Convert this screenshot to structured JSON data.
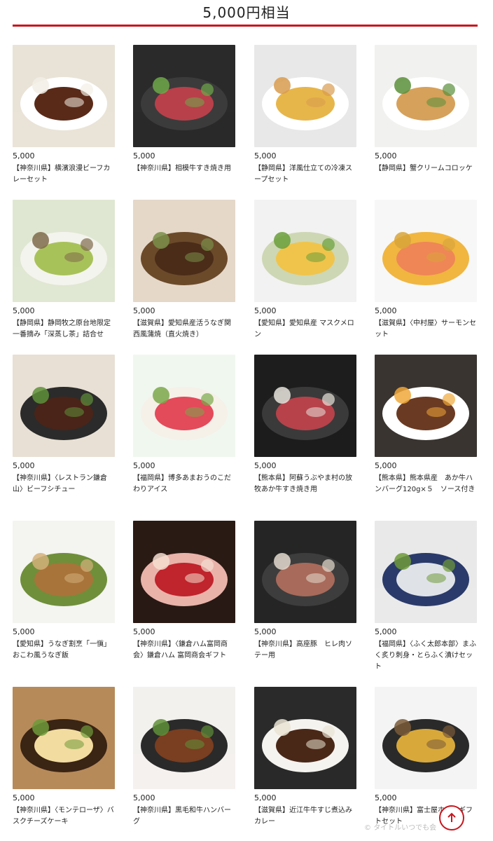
{
  "page_title": "5,000円相当",
  "accent_color": "#c8161d",
  "products": [
    {
      "price": "5,000",
      "name": "【神奈川県】横濱浪漫ビーフカレーセット",
      "thumb": "beef-curry-plate"
    },
    {
      "price": "5,000",
      "name": "【神奈川県】相模牛すき焼き用",
      "thumb": "sukiyaki-pan"
    },
    {
      "price": "5,000",
      "name": "【静岡県】洋風仕立ての冷凍スープセット",
      "thumb": "soup-bowls"
    },
    {
      "price": "5,000",
      "name": "【静岡県】蟹クリームコロッケ",
      "thumb": "croquettes"
    },
    {
      "price": "5,000",
      "name": "【静岡県】静岡牧之原台地限定一番摘み「深蒸し茶」詰合せ",
      "thumb": "green-tea"
    },
    {
      "price": "5,000",
      "name": "【滋賀県】愛知県産活うなぎ関西風蒲焼（直火焼き）",
      "thumb": "eel-kabayaki"
    },
    {
      "price": "5,000",
      "name": "【愛知県】愛知県産 マスクメロン",
      "thumb": "melon"
    },
    {
      "price": "5,000",
      "name": "【滋賀県】〈中村屋〉サーモンセット",
      "thumb": "salmon-set"
    },
    {
      "price": "5,000",
      "name": "【神奈川県】〈レストラン鎌倉山〉ビーフシチュー",
      "thumb": "beef-stew"
    },
    {
      "price": "5,000",
      "name": "【福岡県】博多あまおうのこだわりアイス",
      "thumb": "strawberry-ice"
    },
    {
      "price": "5,000",
      "name": "【熊本県】阿蘇うぶやま村の放牧あか牛すき焼き用",
      "thumb": "sukiyaki-pot"
    },
    {
      "price": "5,000",
      "name": "【熊本県】熊本県産　あか牛ハンバーグ120g×５　ソース付き",
      "thumb": "hamburg-steak"
    },
    {
      "price": "5,000",
      "name": "【愛知県】うなぎ割烹「一愼」おこわ風うなぎ飯",
      "thumb": "unagi-rice"
    },
    {
      "price": "5,000",
      "name": "【神奈川県】〈鎌倉ハム富岡商会〉鎌倉ハム 富岡商会ギフト",
      "thumb": "ham-gift"
    },
    {
      "price": "5,000",
      "name": "【神奈川県】高座豚　ヒレ肉ソテー用",
      "thumb": "pork-saute"
    },
    {
      "price": "5,000",
      "name": "【福岡県】〈ふく太郎本部〉まふく炙り刺身・とらふく漬けセット",
      "thumb": "fugu-sashimi"
    },
    {
      "price": "5,000",
      "name": "【神奈川県】〈モンテローザ〉バスクチーズケーキ",
      "thumb": "basque-cheesecake"
    },
    {
      "price": "5,000",
      "name": "【神奈川県】黒毛和牛ハンバーグ",
      "thumb": "wagyu-hamburg"
    },
    {
      "price": "5,000",
      "name": "【滋賀県】近江牛牛すじ煮込みカレー",
      "thumb": "suji-curry"
    },
    {
      "price": "5,000",
      "name": "【神奈川県】富士屋ホテルギフトセット",
      "thumb": "hotel-gift"
    }
  ],
  "scroll_top_icon": "arrow-up-icon",
  "watermark": "タイトルいつでも会",
  "watermark_icon": "copyright-icon"
}
